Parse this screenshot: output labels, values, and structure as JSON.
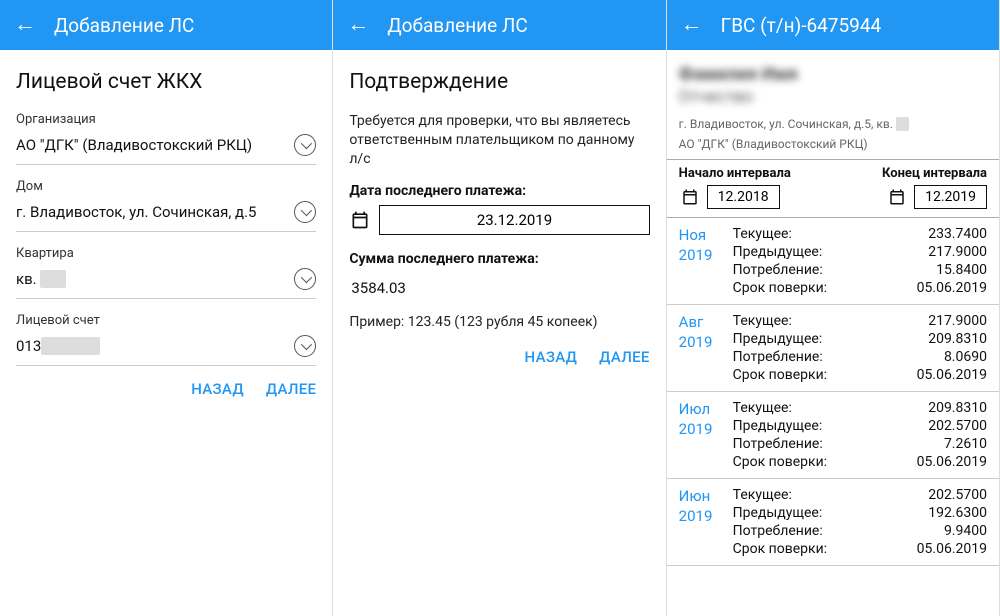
{
  "panel1": {
    "appbar_title": "Добавление ЛС",
    "title": "Лицевой счет ЖКХ",
    "fields": {
      "org_label": "Организация",
      "org_value": "АО \"ДГК\" (Владивостокский РКЦ)",
      "house_label": "Дом",
      "house_value": "г. Владивосток, ул. Сочинская, д.5",
      "apt_label": "Квартира",
      "apt_value": "кв. ",
      "acct_label": "Лицевой счет",
      "acct_value": "013"
    },
    "back_label": "НАЗАД",
    "next_label": "ДАЛЕЕ"
  },
  "panel2": {
    "appbar_title": "Добавление ЛС",
    "title": "Подтверждение",
    "description": "Требуется для проверки, что вы являетесь ответственным плательщиком по данному л/с",
    "date_label": "Дата последнего платежа:",
    "date_value": "23.12.2019",
    "sum_label": "Сумма последнего платежа:",
    "sum_value": "3584.03",
    "hint": "Пример: 123.45 (123 рубля 45 копеек)",
    "back_label": "НАЗАД",
    "next_label": "ДАЛЕЕ"
  },
  "panel3": {
    "appbar_title": "ГВС (т/н)-6475944",
    "name_line1": "Фамилия Имя",
    "name_line2": "Отчество",
    "address": "г. Владивосток, ул. Сочинская, д.5, кв. ",
    "org": "АО \"ДГК\" (Владивостокский РКЦ)",
    "interval_start_label": "Начало интервала",
    "interval_start_value": "12.2018",
    "interval_end_label": "Конец интервала",
    "interval_end_value": "12.2019",
    "row_labels": {
      "current": "Текущее:",
      "previous": "Предыдущее:",
      "consumption": "Потребление:",
      "check_date": "Срок поверки:"
    },
    "readings": [
      {
        "month": "Ноя",
        "year": "2019",
        "current": "233.7400",
        "previous": "217.9000",
        "consumption": "15.8400",
        "check": "05.06.2019"
      },
      {
        "month": "Авг",
        "year": "2019",
        "current": "217.9000",
        "previous": "209.8310",
        "consumption": "8.0690",
        "check": "05.06.2019"
      },
      {
        "month": "Июл",
        "year": "2019",
        "current": "209.8310",
        "previous": "202.5700",
        "consumption": "7.2610",
        "check": "05.06.2019"
      },
      {
        "month": "Июн",
        "year": "2019",
        "current": "202.5700",
        "previous": "192.6300",
        "consumption": "9.9400",
        "check": "05.06.2019"
      }
    ]
  }
}
